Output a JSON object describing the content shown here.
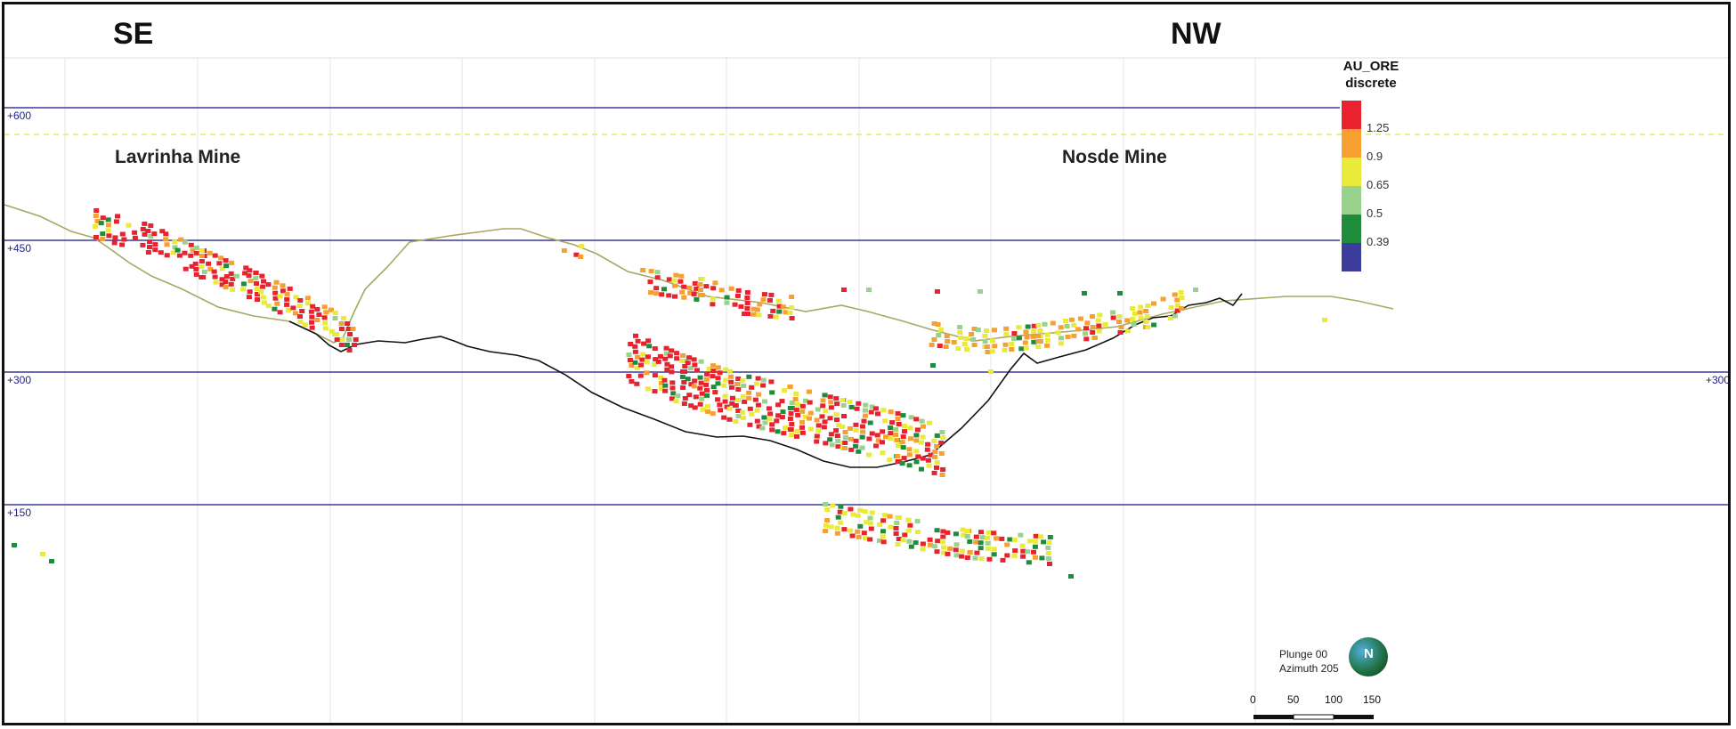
{
  "header": {
    "left_direction": "SE",
    "right_direction": "NW"
  },
  "mines": {
    "left": "Lavrinha Mine",
    "right": "Nosde Mine"
  },
  "elevations": {
    "e600": "+600",
    "e450": "+450",
    "e300": "+300",
    "e150": "+150"
  },
  "legend": {
    "title_line1": "AU_ORE",
    "title_line2": "discrete",
    "bins": [
      {
        "color": "#e8222e"
      },
      {
        "color": "#f5a030"
      },
      {
        "color": "#eaea3a"
      },
      {
        "color": "#98d28c"
      },
      {
        "color": "#1e8c3c"
      },
      {
        "color": "#3c3c9a"
      }
    ],
    "ticks": [
      "1.25",
      "0.9",
      "0.65",
      "0.5",
      "0.39"
    ]
  },
  "view": {
    "plunge": "Plunge 00",
    "azimuth": "Azimuth 205",
    "compass_letter": "N"
  },
  "scale": {
    "labels": [
      "0",
      "50",
      "100",
      "150"
    ]
  },
  "colors": {
    "elevation_line": "#3a3a9a",
    "surface": "#a8a860",
    "underground": "#111111",
    "grid": "#e6e6e6"
  }
}
